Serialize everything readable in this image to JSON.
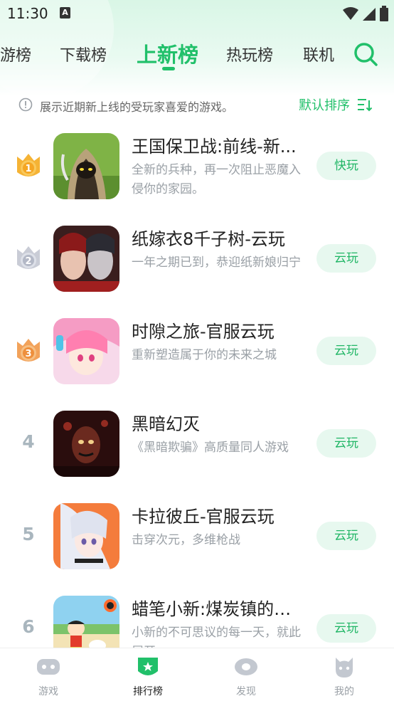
{
  "status_bar": {
    "time": "11:30",
    "notification_letter": "A"
  },
  "tabs": [
    {
      "label": "游榜"
    },
    {
      "label": "下载榜"
    },
    {
      "label": "上新榜"
    },
    {
      "label": "热玩榜"
    },
    {
      "label": "联机"
    }
  ],
  "active_tab": "上新榜",
  "info": {
    "text": "展示近期新上线的受玩家喜爱的游戏。",
    "sort_label": "默认排序"
  },
  "games": [
    {
      "rank": "1",
      "name": "王国保卫战:前线-新...",
      "desc": "全新的兵种，再一次阻止恶魔入侵你的家园。",
      "button": "快玩"
    },
    {
      "rank": "2",
      "name": "纸嫁衣8千子树-云玩",
      "desc": "一年之期已到，恭迎纸新娘归宁",
      "button": "云玩"
    },
    {
      "rank": "3",
      "name": "时隙之旅-官服云玩",
      "desc": "重新塑造属于你的未来之城",
      "button": "云玩"
    },
    {
      "rank": "4",
      "name": "黑暗幻灭",
      "desc": "《黑暗欺骗》高质量同人游戏",
      "button": "云玩"
    },
    {
      "rank": "5",
      "name": "卡拉彼丘-官服云玩",
      "desc": "击穿次元，多维枪战",
      "button": "云玩"
    },
    {
      "rank": "6",
      "name": "蜡笔小新:煤炭镇的小...",
      "desc": "小新的不可思议的每一天，就此展开",
      "button": "云玩"
    }
  ],
  "bottom_nav": [
    {
      "label": "游戏",
      "icon": "gamepad-icon"
    },
    {
      "label": "排行榜",
      "icon": "ranking-icon"
    },
    {
      "label": "发现",
      "icon": "eye-icon"
    },
    {
      "label": "我的",
      "icon": "mascot-icon"
    }
  ],
  "active_nav": "排行榜",
  "colors": {
    "accent": "#21c06a",
    "button_bg": "#e7f8ef",
    "gold_medal": "#f5b335",
    "silver_medal": "#c9ccd6",
    "bronze_medal": "#f2a25a",
    "rank_gray": "#a9b6be"
  }
}
